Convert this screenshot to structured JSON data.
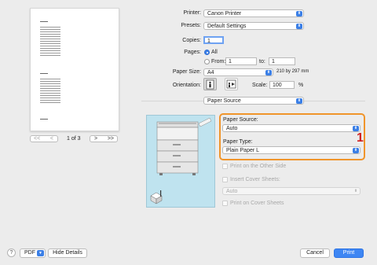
{
  "preview": {
    "page_indicator": "1 of 3",
    "first_label": "<<",
    "prev_label": "<",
    "next_label": ">",
    "last_label": ">>"
  },
  "printer": {
    "label": "Printer:",
    "value": "Canon Printer"
  },
  "presets": {
    "label": "Presets:",
    "value": "Default Settings"
  },
  "copies": {
    "label": "Copies:",
    "value": "1"
  },
  "pages": {
    "label": "Pages:",
    "all_label": "All",
    "from_label": "From:",
    "from_value": "1",
    "to_label": "to:",
    "to_value": "1"
  },
  "paper_size": {
    "label": "Paper Size:",
    "value": "A4",
    "dimensions": "210 by 297 mm"
  },
  "orientation": {
    "label": "Orientation:",
    "scale_label": "Scale:",
    "scale_value": "100",
    "percent": "%"
  },
  "section_popup": {
    "value": "Paper Source"
  },
  "paper_source": {
    "label": "Paper Source:",
    "value": "Auto"
  },
  "paper_type": {
    "label": "Paper Type:",
    "value": "Plain Paper L"
  },
  "callout_number": "1",
  "options": {
    "print_other_side": "Print on the Other Side",
    "insert_cover_sheets": "Insert Cover Sheets:",
    "cover_value": "Auto",
    "print_on_cover": "Print on Cover Sheets"
  },
  "bottom": {
    "help": "?",
    "pdf_label": "PDF",
    "hide_details": "Hide Details",
    "cancel": "Cancel",
    "print": "Print"
  },
  "colors": {
    "accent": "#3b7fe6",
    "highlight": "#f0952b",
    "callout": "#d01f1f"
  }
}
